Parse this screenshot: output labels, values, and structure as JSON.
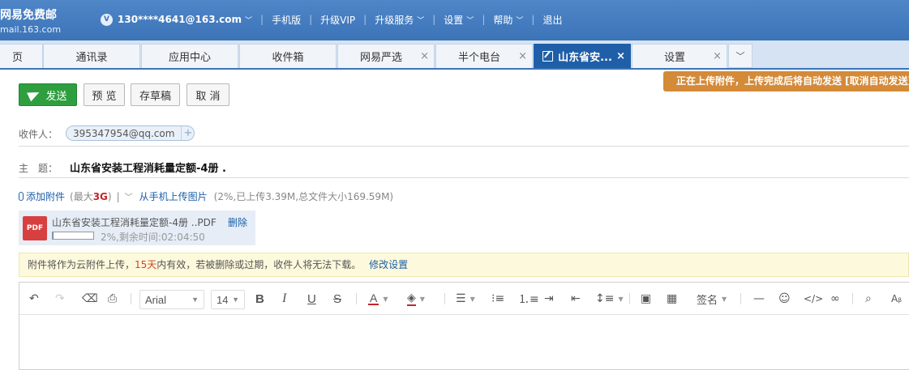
{
  "header": {
    "brand_line1": "网易免费邮",
    "brand_line2": "mail.163.com",
    "vip_badge": "V",
    "user": "130****4641@163.com",
    "links": [
      "手机版",
      "升级VIP",
      "升级服务",
      "设置",
      "帮助",
      "退出"
    ]
  },
  "tabs": [
    {
      "label": "页",
      "closable": false,
      "active": false
    },
    {
      "label": "通讯录",
      "closable": false,
      "active": false
    },
    {
      "label": "应用中心",
      "closable": false,
      "active": false
    },
    {
      "label": "收件箱",
      "closable": false,
      "active": false
    },
    {
      "label": "网易严选",
      "closable": true,
      "active": false
    },
    {
      "label": "半个电台",
      "closable": true,
      "active": false
    },
    {
      "label": "山东省安...",
      "closable": true,
      "active": true
    },
    {
      "label": "设置",
      "closable": true,
      "active": false
    }
  ],
  "upload_notice": "正在上传附件，上传完成后将自动发送 [取消自动发送]",
  "actions": {
    "send": "发送",
    "preview": "预 览",
    "draft": "存草稿",
    "cancel": "取 消"
  },
  "compose": {
    "recipient_label": "收件人：",
    "recipient": "395347954@qq.com",
    "subject_label": "主　题：",
    "subject": "山东省安装工程消耗量定额-4册 ."
  },
  "attachment": {
    "add_label": "添加附件",
    "max_prefix": "(最大",
    "max_size": "3G",
    "max_suffix": ")",
    "phone_upload": "从手机上传图片",
    "status": "(2%,已上传3.39M,总文件大小169.59M)",
    "file_icon": "PDF",
    "file_name": "山东省安装工程消耗量定额-4册 ..PDF",
    "delete": "删除",
    "progress": 0.02,
    "remaining": "2%,剩余时间:02:04:50"
  },
  "cloud_notice": {
    "before": "附件将作为云附件上传，",
    "days": "15天",
    "after": "内有效，若被删除或过期，收件人将无法下载。",
    "link": "修改设置"
  },
  "editor": {
    "font": "Arial",
    "size": "14",
    "signature": "签名"
  },
  "colors": {
    "header_blue": "#3c74b8",
    "active_tab": "#1f5fa8",
    "send_green": "#2f9e3f",
    "notice_orange": "#d48a38"
  }
}
